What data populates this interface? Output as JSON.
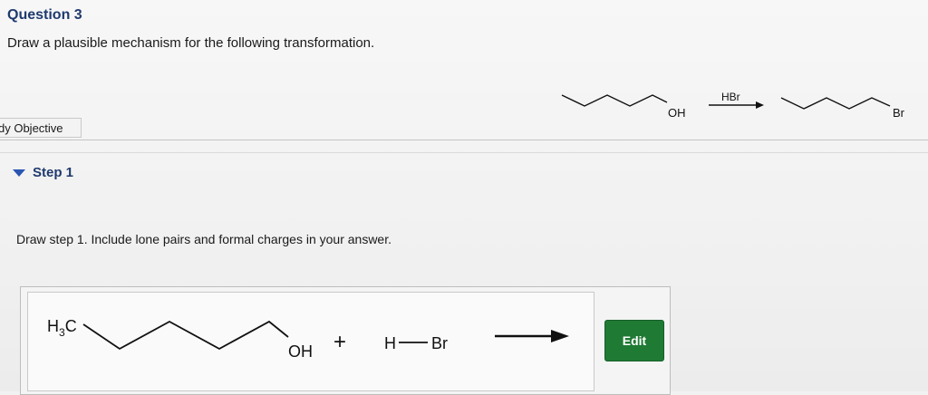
{
  "question": {
    "title": "Question 3",
    "prompt": "Draw a plausible mechanism for the following transformation."
  },
  "reaction": {
    "reactant_label": "OH",
    "reagent": "HBr",
    "product_label": "Br"
  },
  "objective_tab": {
    "label": "dy Objective"
  },
  "step": {
    "label": "Step 1",
    "instruction": "Draw step 1. Include lone pairs and formal charges in your answer."
  },
  "answer": {
    "h3c_main": "H",
    "h3c_sub": "3",
    "h3c_tail": "C",
    "oh_label": "OH",
    "plus": "+",
    "hbr_h": "H",
    "hbr_br": "Br",
    "edit_label": "Edit"
  },
  "colors": {
    "accent_blue": "#1f3a6e",
    "edit_green": "#1f7a34"
  }
}
